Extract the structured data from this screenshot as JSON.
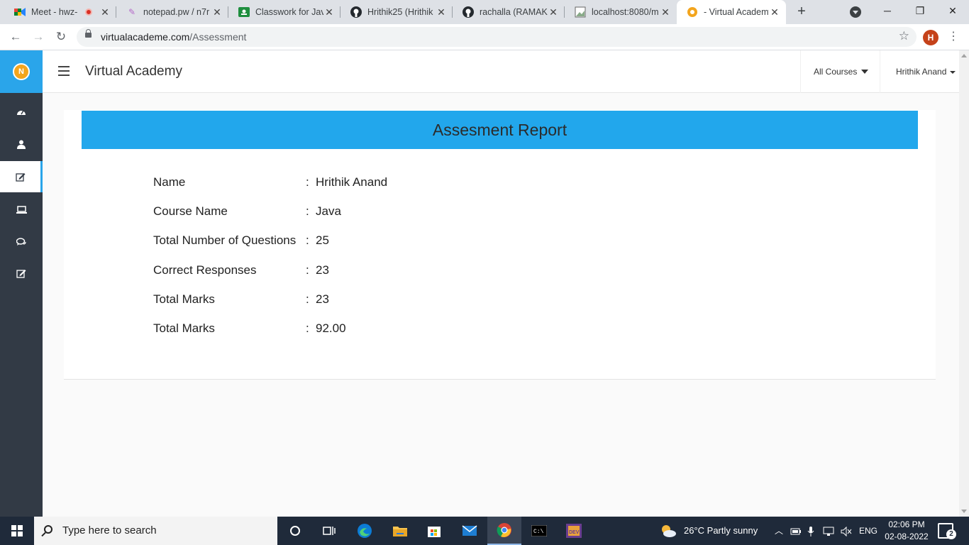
{
  "browser": {
    "tabs": [
      {
        "title": "Meet - hwz-",
        "icon": "google-meet-icon",
        "recording": true
      },
      {
        "title": "notepad.pw / n7r",
        "icon": "notepad-icon"
      },
      {
        "title": "Classwork for Jav",
        "icon": "google-classroom-icon"
      },
      {
        "title": "Hrithik25 (Hrithik",
        "icon": "github-icon"
      },
      {
        "title": "rachalla (RAMAKR",
        "icon": "github-icon"
      },
      {
        "title": "localhost:8080/m",
        "icon": "page-icon"
      },
      {
        "title": "- Virtual Academy",
        "icon": "virtual-academy-icon"
      }
    ],
    "url_domain": "virtualacademe.com",
    "url_path": "/Assessment",
    "profile_initial": "H"
  },
  "app": {
    "brand": "Virtual Academy",
    "all_courses_label": "All Courses",
    "user_name": "Hrithik Anand",
    "sidebar": [
      {
        "icon": "dashboard-icon",
        "active": false
      },
      {
        "icon": "user-icon",
        "active": false
      },
      {
        "icon": "edit-icon",
        "active": true
      },
      {
        "icon": "laptop-icon",
        "active": false
      },
      {
        "icon": "comments-icon",
        "active": false
      },
      {
        "icon": "edit-icon",
        "active": false
      }
    ],
    "accent_color": "#22a7ec",
    "sidebar_color": "#323a45"
  },
  "report": {
    "title": "Assesment Report",
    "rows": [
      {
        "label": "Name",
        "value": "Hrithik Anand"
      },
      {
        "label": "Course Name",
        "value": "Java"
      },
      {
        "label": "Total Number of Questions",
        "value": "25"
      },
      {
        "label": "Correct Responses",
        "value": "23"
      },
      {
        "label": "Total Marks",
        "value": "23"
      },
      {
        "label": "Total Marks",
        "value": "92.00"
      }
    ],
    "separator": ":"
  },
  "taskbar": {
    "search_placeholder": "Type here to search",
    "weather": "26°C  Partly sunny",
    "language": "ENG",
    "time": "02:06 PM",
    "date": "02-08-2022",
    "notification_count": "2"
  }
}
